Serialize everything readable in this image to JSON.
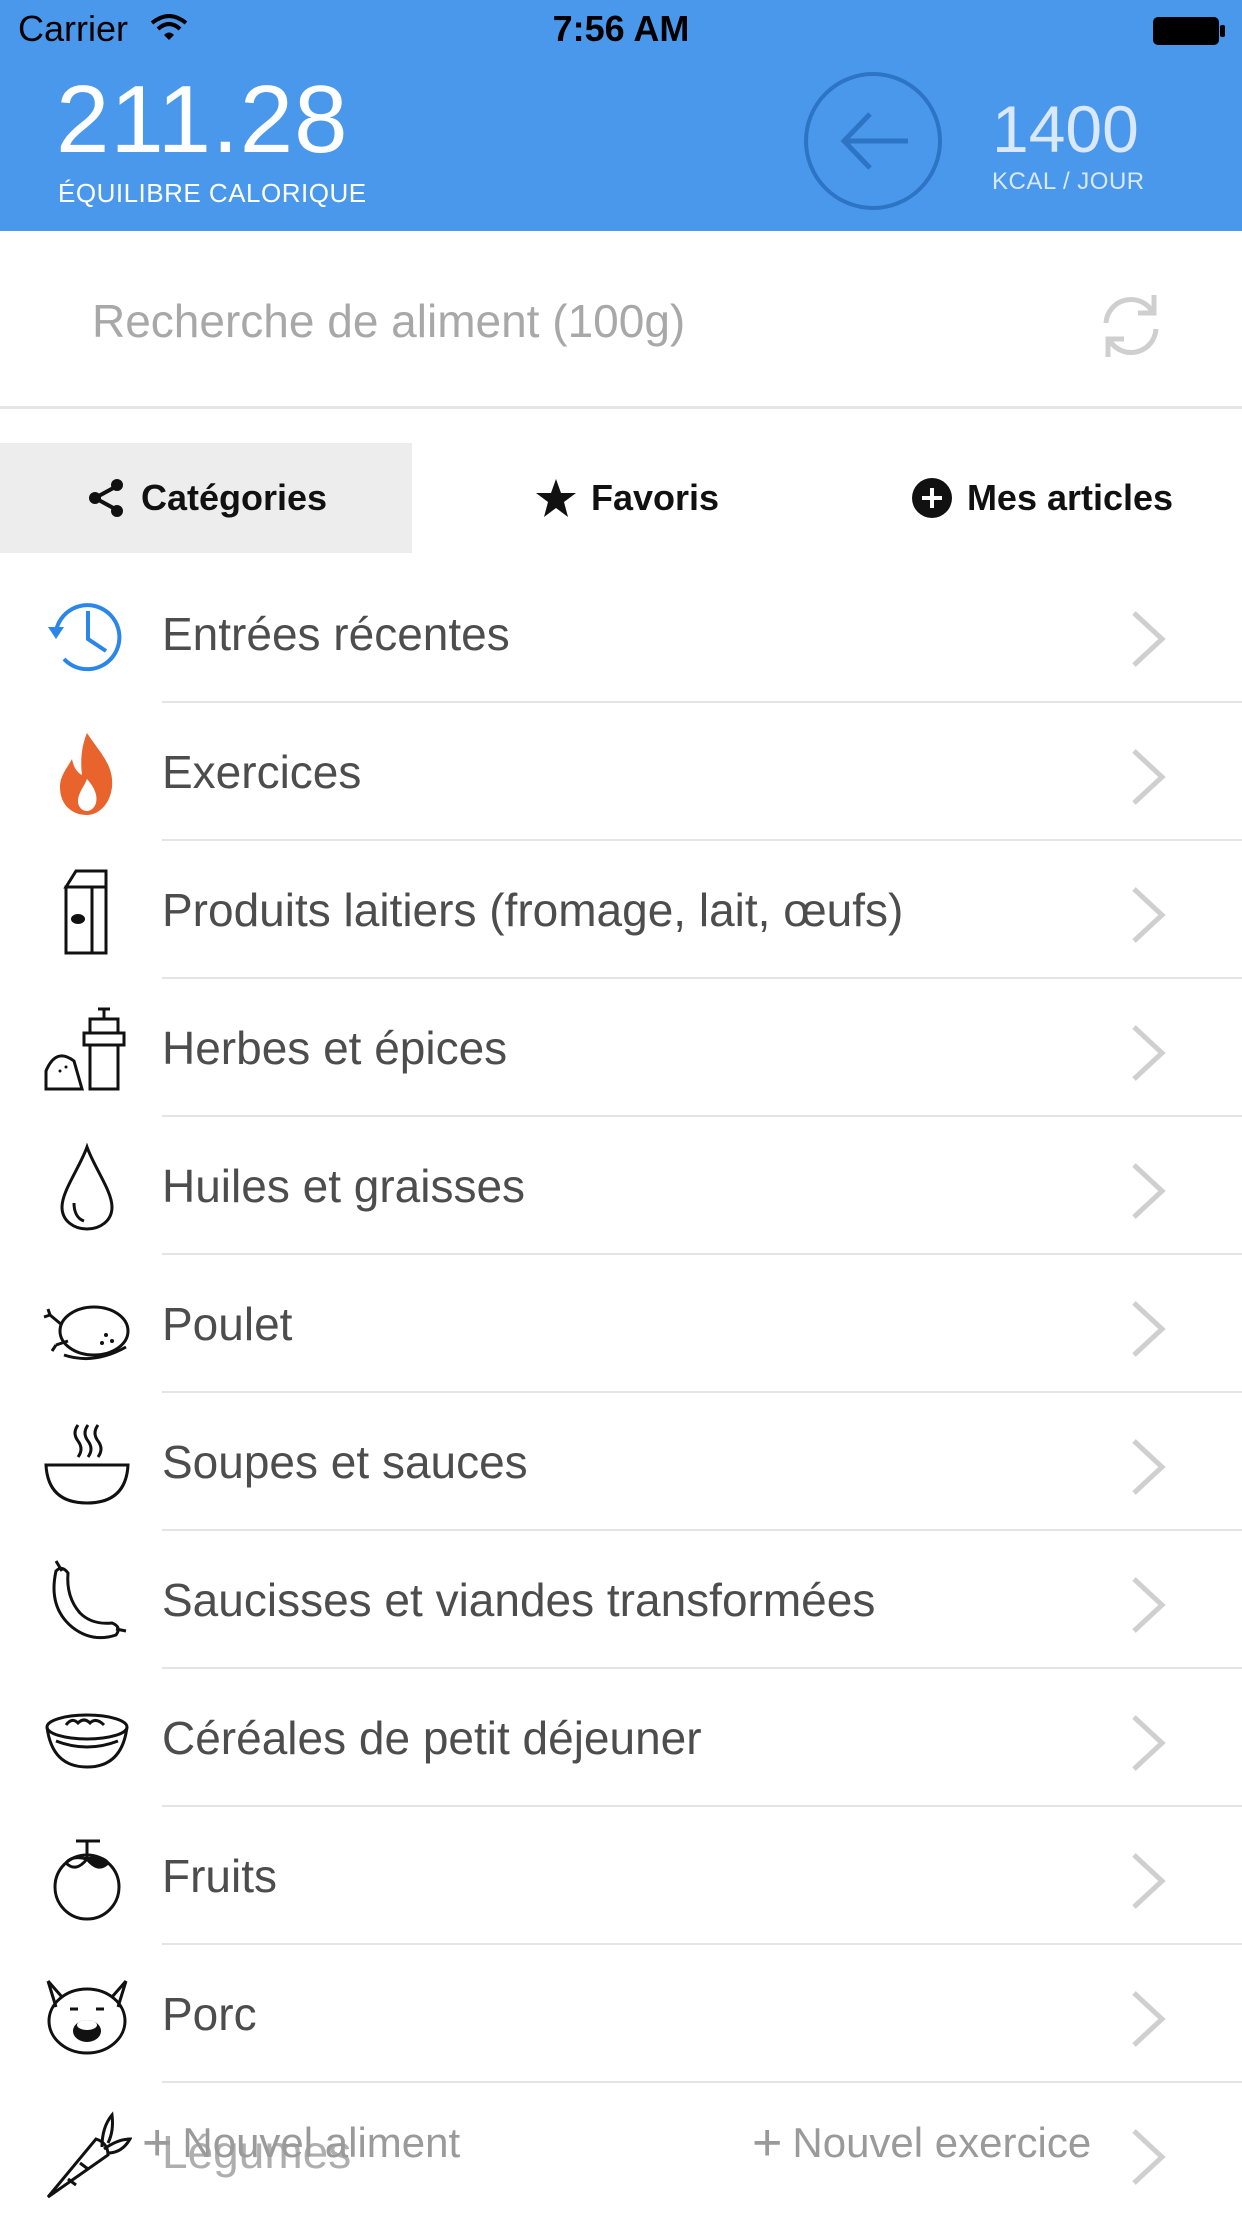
{
  "status_bar": {
    "carrier": "Carrier",
    "time": "7:56 AM"
  },
  "header": {
    "balance_value": "211.28",
    "balance_label": "ÉQUILIBRE CALORIQUE",
    "kcal_value": "1400",
    "kcal_label": "KCAL / JOUR",
    "accent_color": "#4a98ec"
  },
  "search": {
    "placeholder": "Recherche de aliment (100g)"
  },
  "tabs": [
    {
      "label": "Catégories",
      "icon": "share-icon",
      "active": true
    },
    {
      "label": "Favoris",
      "icon": "star-icon",
      "active": false
    },
    {
      "label": "Mes articles",
      "icon": "plus-circle-icon",
      "active": false
    }
  ],
  "categories": [
    {
      "label": "Entrées récentes",
      "icon": "clock-history-icon"
    },
    {
      "label": "Exercices",
      "icon": "flame-icon"
    },
    {
      "label": "Produits laitiers (fromage, lait, œufs)",
      "icon": "milk-carton-icon"
    },
    {
      "label": "Herbes et épices",
      "icon": "spice-grinder-icon"
    },
    {
      "label": "Huiles et graisses",
      "icon": "oil-drop-icon"
    },
    {
      "label": "Poulet",
      "icon": "roast-chicken-icon"
    },
    {
      "label": "Soupes et sauces",
      "icon": "soup-bowl-icon"
    },
    {
      "label": "Saucisses et viandes transformées",
      "icon": "sausage-icon"
    },
    {
      "label": "Céréales de petit déjeuner",
      "icon": "cereal-bowl-icon"
    },
    {
      "label": "Fruits",
      "icon": "fruit-icon"
    },
    {
      "label": "Porc",
      "icon": "pig-icon"
    },
    {
      "label": "Légumes",
      "icon": "carrot-icon"
    }
  ],
  "bottom": {
    "new_food": "Nouvel aliment",
    "new_exercise": "Nouvel exercice"
  }
}
